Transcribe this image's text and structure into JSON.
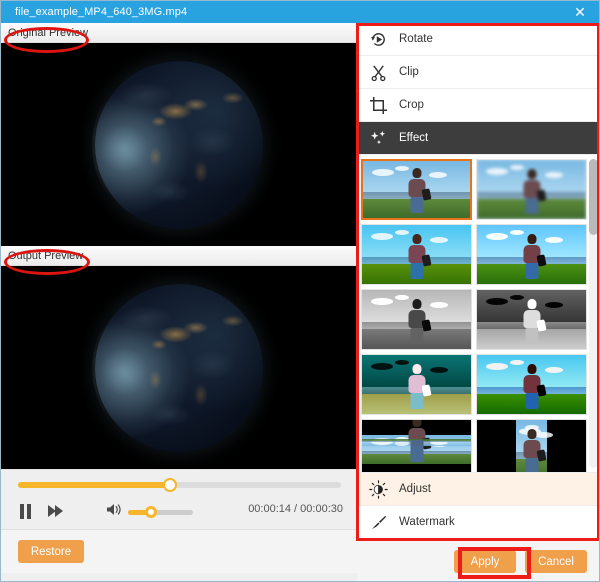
{
  "window": {
    "title": "file_example_MP4_640_3MG.mp4",
    "close_label": "✕"
  },
  "preview": {
    "original_label": "Original Preview",
    "output_label": "Output Preview",
    "video_subject": "earth-at-night-from-space"
  },
  "player": {
    "pause_icon": "pause-icon",
    "next_icon": "fast-forward-icon",
    "volume_icon": "speaker-icon",
    "time_display": "00:00:14 / 00:00:30",
    "current_time": "00:00:14",
    "total_time": "00:00:30",
    "timeline_percent": 47,
    "volume_percent": 35
  },
  "footer_left": {
    "restore_label": "Restore"
  },
  "menu": {
    "items": [
      {
        "label": "Rotate",
        "icon": "rotate-icon",
        "state": "normal"
      },
      {
        "label": "Clip",
        "icon": "scissors-icon",
        "state": "normal"
      },
      {
        "label": "Crop",
        "icon": "crop-icon",
        "state": "normal"
      },
      {
        "label": "Effect",
        "icon": "sparkles-icon",
        "state": "active"
      }
    ],
    "bottom_items": [
      {
        "label": "Adjust",
        "icon": "brightness-icon",
        "state": "hover"
      },
      {
        "label": "Watermark",
        "icon": "brush-icon",
        "state": "normal"
      }
    ]
  },
  "effects": {
    "selected_index": 0,
    "thumbnails": [
      {
        "name": "Original",
        "style": "t-orig",
        "selected": true
      },
      {
        "name": "Blur",
        "style": "t-blur",
        "selected": false
      },
      {
        "name": "Warm",
        "style": "t-warm",
        "selected": false
      },
      {
        "name": "Vivid",
        "style": "t-cool",
        "selected": false
      },
      {
        "name": "Gray",
        "style": "t-gray",
        "selected": false
      },
      {
        "name": "Sketch",
        "style": "t-sketch",
        "selected": false
      },
      {
        "name": "Negative",
        "style": "t-invert",
        "selected": false
      },
      {
        "name": "Sharpen",
        "style": "t-sharp",
        "selected": false
      },
      {
        "name": "Mirror",
        "style": "t-mirror",
        "selected": false
      },
      {
        "name": "Pillarbox",
        "style": "t-pillar",
        "selected": false
      }
    ],
    "scroll_percent": 0
  },
  "footer_right": {
    "apply_label": "Apply",
    "cancel_label": "Cancel"
  },
  "colors": {
    "titlebar": "#29a3e0",
    "accent_orange": "#f0a04b",
    "slider_orange": "#f7b52c",
    "selection_orange": "#e8731b",
    "annotation_red": "#ee1c18",
    "active_menu": "#3d3d3d",
    "hover_menu": "#fdf2e5"
  },
  "annotations": [
    {
      "name": "right-panel-highlight",
      "shape": "rectangle"
    },
    {
      "name": "apply-button-highlight",
      "shape": "rectangle"
    },
    {
      "name": "original-preview-highlight",
      "shape": "ellipse"
    },
    {
      "name": "output-preview-highlight",
      "shape": "ellipse"
    }
  ]
}
